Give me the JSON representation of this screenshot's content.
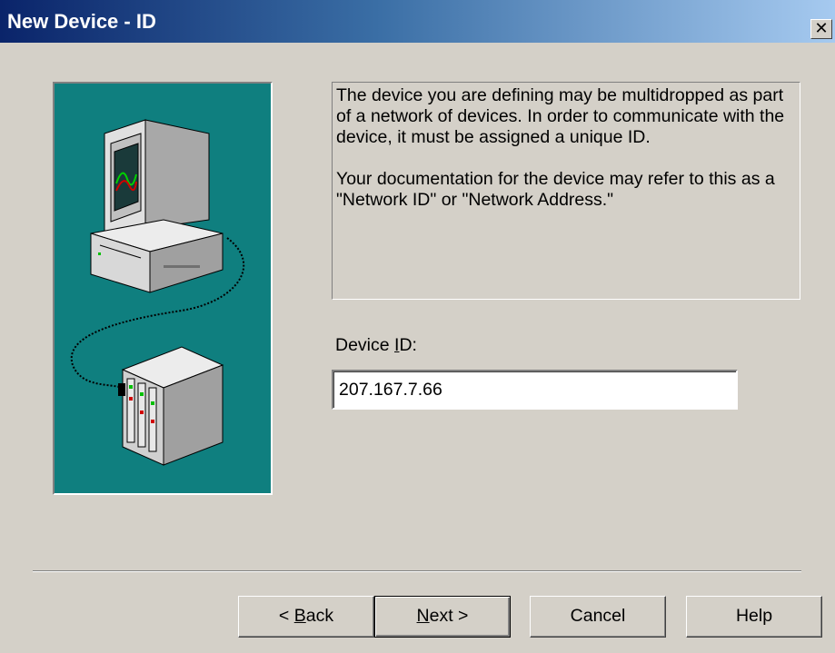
{
  "window": {
    "title": "New Device - ID",
    "close_glyph": "✕"
  },
  "info": {
    "paragraph1": "The device you are defining may be multidropped as part of a network of devices.  In order to communicate with the device, it must be assigned a unique ID.",
    "paragraph2": "Your documentation for the device may refer to this as a \"Network ID\" or \"Network Address.\""
  },
  "device_id": {
    "label_before": "Device ",
    "label_mnemonic": "I",
    "label_after": "D:",
    "value": "207.167.7.66"
  },
  "buttons": {
    "back_prefix": "< ",
    "back_mnemonic": "B",
    "back_rest": "ack",
    "next_mnemonic": "N",
    "next_rest": "ext >",
    "cancel": "Cancel",
    "help": "Help"
  },
  "colors": {
    "picture_bg": "#0f7f7f",
    "dialog_bg": "#d4d0c8",
    "title_start": "#0a246a",
    "title_end": "#a6caf0"
  },
  "icons": {
    "illustration": "computer-connected-to-device-rack",
    "close": "close-icon"
  }
}
